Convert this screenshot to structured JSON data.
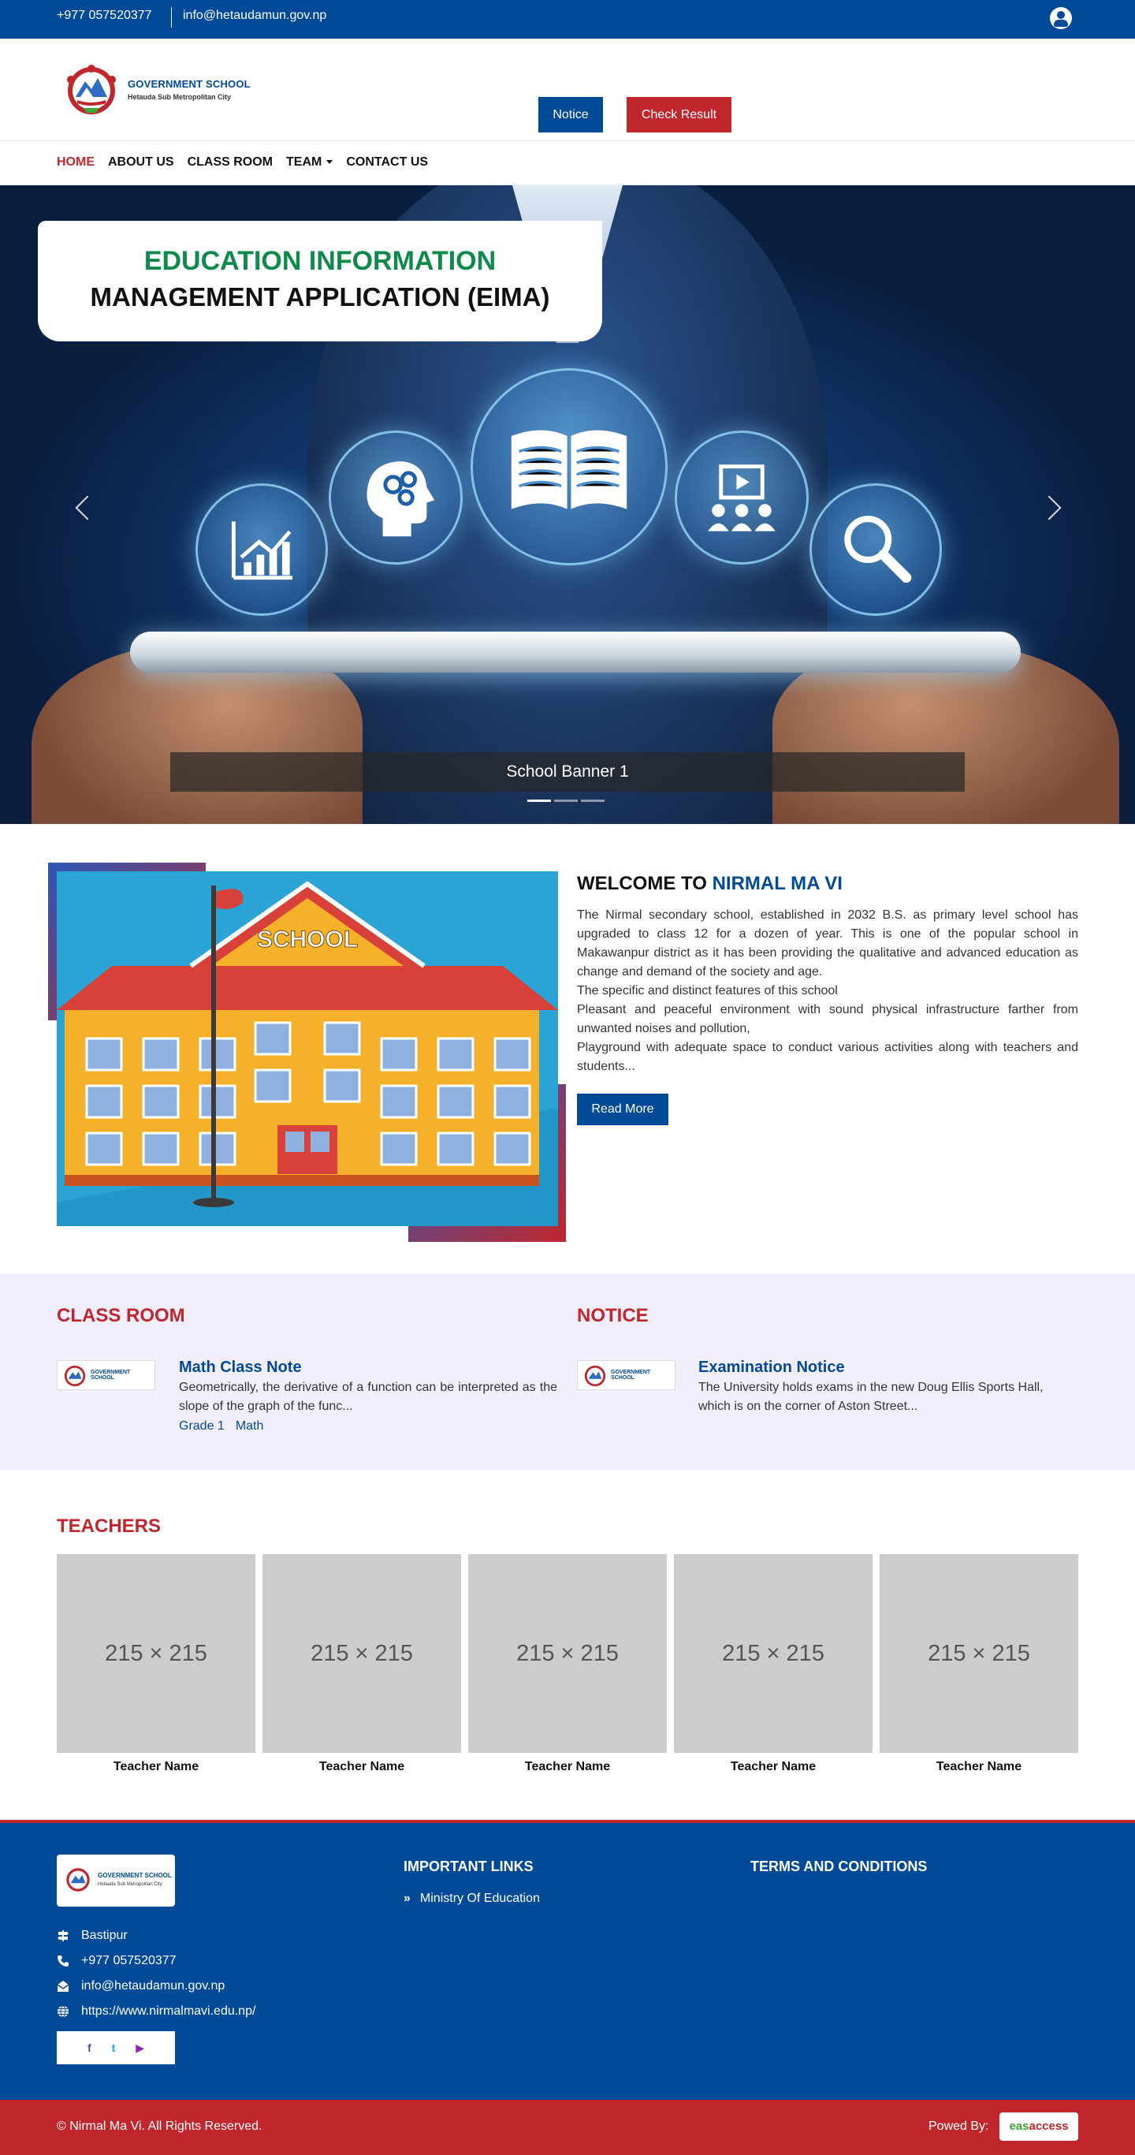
{
  "topbar": {
    "phone": "+977 057520377",
    "email": "info@hetaudamun.gov.np",
    "user_icon": "user-circle-icon"
  },
  "header": {
    "school_name": "GOVERNMENT SCHOOL",
    "school_sub": "Hetauda Sub Metropolitan City",
    "notice_button": "Notice",
    "check_result_button": "Check Result"
  },
  "nav": {
    "items": [
      "HOME",
      "ABOUT US",
      "CLASS ROOM",
      "TEAM",
      "CONTACT US"
    ],
    "active": "HOME"
  },
  "hero": {
    "title_line1": "EDUCATION INFORMATION",
    "title_line2": "MANAGEMENT APPLICATION (EIMA)",
    "caption": "School Banner 1",
    "slide_count": 3,
    "active_slide": 1,
    "bubble_icons": [
      "bar-chart-icon",
      "head-gears-icon",
      "open-book-icon",
      "video-audience-icon",
      "magnifier-icon"
    ]
  },
  "welcome": {
    "heading_prefix": "WELCOME TO",
    "heading_highlight": "NIRMAL MA VI",
    "image_label": "SCHOOL",
    "paragraph": "The Nirmal secondary school, established in 2032 B.S. as primary level school has upgraded to class 12 for a dozen of year. This is one of the popular school in Makawanpur district as it has been providing the qualitative and advanced education as change and demand of the society and age.",
    "line2": "The specific and distinct features of this school",
    "line3": "Pleasant and peaceful environment with sound physical infrastructure farther from unwanted noises and pollution,",
    "line4": "Playground with adequate space to  conduct various activities along with teachers and students...",
    "read_more": "Read More"
  },
  "class_room": {
    "heading": "CLASS ROOM",
    "item_title": "Math Class Note",
    "item_desc": "Geometrically, the derivative of a function can be interpreted as the slope of the graph of the func...",
    "tags": [
      "Grade 1",
      "Math"
    ]
  },
  "notice": {
    "heading": "NOTICE",
    "item_title": "Examination Notice",
    "item_desc": "The University holds exams in the new Doug Ellis Sports Hall, which is on the corner of Aston Street..."
  },
  "teachers": {
    "heading": "TEACHERS",
    "cards": [
      {
        "photo": "215 × 215",
        "name": "Teacher Name"
      },
      {
        "photo": "215 × 215",
        "name": "Teacher Name"
      },
      {
        "photo": "215 × 215",
        "name": "Teacher Name"
      },
      {
        "photo": "215 × 215",
        "name": "Teacher Name"
      },
      {
        "photo": "215 × 215",
        "name": "Teacher Name"
      }
    ]
  },
  "footer": {
    "logo_name": "GOVERNMENT SCHOOL",
    "logo_sub": "Hetauda Sub Metropolitan City",
    "address": "Bastipur",
    "phone": "+977 057520377",
    "email": "info@hetaudamun.gov.np",
    "website": "https://www.nirmalmavi.edu.np/",
    "links_heading": "IMPORTANT LINKS",
    "link1": "Ministry Of Education",
    "terms_heading": "TERMS AND CONDITIONS",
    "social": [
      "f",
      "t",
      "▶"
    ],
    "copyright": "© Nirmal Ma Vi. All Rights Reserved.",
    "powered_by": "Powed By:",
    "powered_logo_a": "eas",
    "powered_logo_b": "access"
  },
  "colors": {
    "primary": "#004a97",
    "accent": "#c0272d",
    "green_title": "#0e8a4a",
    "info_bg": "#f3eefc"
  }
}
